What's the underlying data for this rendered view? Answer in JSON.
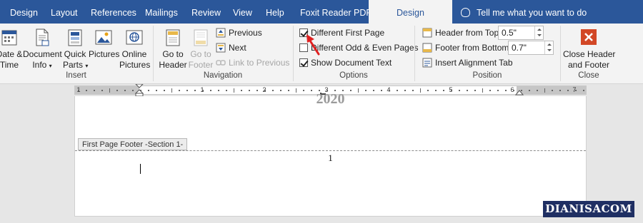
{
  "tabs": [
    {
      "label": "Design",
      "active": false
    },
    {
      "label": "Layout",
      "active": false
    },
    {
      "label": "References",
      "active": false
    },
    {
      "label": "Mailings",
      "active": false
    },
    {
      "label": "Review",
      "active": false
    },
    {
      "label": "View",
      "active": false
    },
    {
      "label": "Help",
      "active": false
    },
    {
      "label": "Foxit Reader PDF",
      "active": false
    },
    {
      "label": "Design",
      "active": true
    }
  ],
  "tell_me": "Tell me what you want to do",
  "insert_group": {
    "label": "Insert",
    "date_time": [
      "Date &",
      "Time"
    ],
    "document_info": [
      "Document",
      "Info"
    ],
    "quick_parts": [
      "Quick",
      "Parts"
    ],
    "pictures": "Pictures",
    "online_pictures": [
      "Online",
      "Pictures"
    ]
  },
  "navigation_group": {
    "label": "Navigation",
    "go_to_header": [
      "Go to",
      "Header"
    ],
    "go_to_footer": [
      "Go to",
      "Footer"
    ],
    "previous": "Previous",
    "next": "Next",
    "link_to_previous": "Link to Previous"
  },
  "options_group": {
    "label": "Options",
    "different_first_page": {
      "label": "Different First Page",
      "checked": true
    },
    "different_odd_even": {
      "label": "Different Odd & Even Pages",
      "checked": false
    },
    "show_document_text": {
      "label": "Show Document Text",
      "checked": true
    }
  },
  "position_group": {
    "label": "Position",
    "header_from_top": {
      "label": "Header from Top:",
      "value": "0.5\""
    },
    "footer_from_bottom": {
      "label": "Footer from Bottom:",
      "value": "0.7\""
    },
    "insert_alignment_tab": "Insert Alignment Tab"
  },
  "close_group": {
    "label": "Close",
    "close_button": [
      "Close Header",
      "and Footer"
    ]
  },
  "ruler_numbers": [
    "1",
    "1",
    "2",
    "3",
    "4",
    "5",
    "6",
    "7"
  ],
  "document": {
    "year_text": "2020",
    "footer_tag": "First Page Footer -Section 1-",
    "page_number": "1"
  },
  "watermark": "DIANISACOM",
  "colors": {
    "ribbon_tab_bg": "#2b579a",
    "ribbon_bg": "#f3f3f3",
    "close_icon": "#d24726",
    "annotation_arrow": "#e02020",
    "watermark_bg": "#1f2f63"
  }
}
